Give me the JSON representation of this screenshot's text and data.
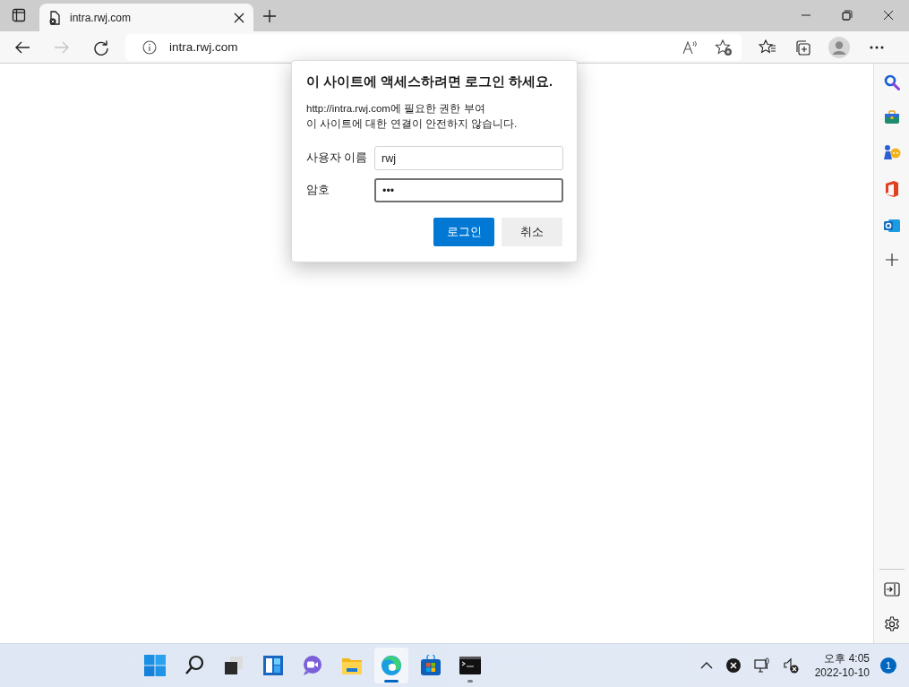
{
  "tabs": [
    {
      "title": "intra.rwj.com",
      "selected": true
    }
  ],
  "nav": [
    {
      "kind": "back",
      "disabled": false
    },
    {
      "kind": "forward",
      "disabled": true
    },
    {
      "kind": "refresh",
      "disabled": false
    }
  ],
  "address": {
    "url": "intra.rwj.com"
  },
  "dialog": {
    "title": "이 사이트에 액세스하려면 로그인 하세요.",
    "lines": [
      "http://intra.rwj.com에 필요한 권한 부여",
      "이 사이트에 대한 연결이 안전하지 않습니다."
    ],
    "fields": [
      {
        "label": "사용자 이름",
        "value": "rwj",
        "focused": false
      },
      {
        "label": "암호",
        "value": "•••",
        "focused": true
      }
    ],
    "buttons": [
      {
        "label": "로그인",
        "primary": true
      },
      {
        "label": "취소",
        "primary": false
      }
    ]
  },
  "taskbar": {
    "apps": [
      {
        "kind": "start",
        "selected": false,
        "running": false
      },
      {
        "kind": "search",
        "selected": false,
        "running": false
      },
      {
        "kind": "taskview",
        "selected": false,
        "running": false
      },
      {
        "kind": "widgets",
        "selected": false,
        "running": false
      },
      {
        "kind": "chat",
        "selected": false,
        "running": false
      },
      {
        "kind": "explorer",
        "selected": false,
        "running": false
      },
      {
        "kind": "edge",
        "selected": true,
        "running": true
      },
      {
        "kind": "store",
        "selected": false,
        "running": false
      },
      {
        "kind": "terminal",
        "selected": false,
        "running": true
      }
    ],
    "clock": {
      "time": "오후 4:05",
      "date": "2022-10-10"
    },
    "notifications": "1"
  }
}
